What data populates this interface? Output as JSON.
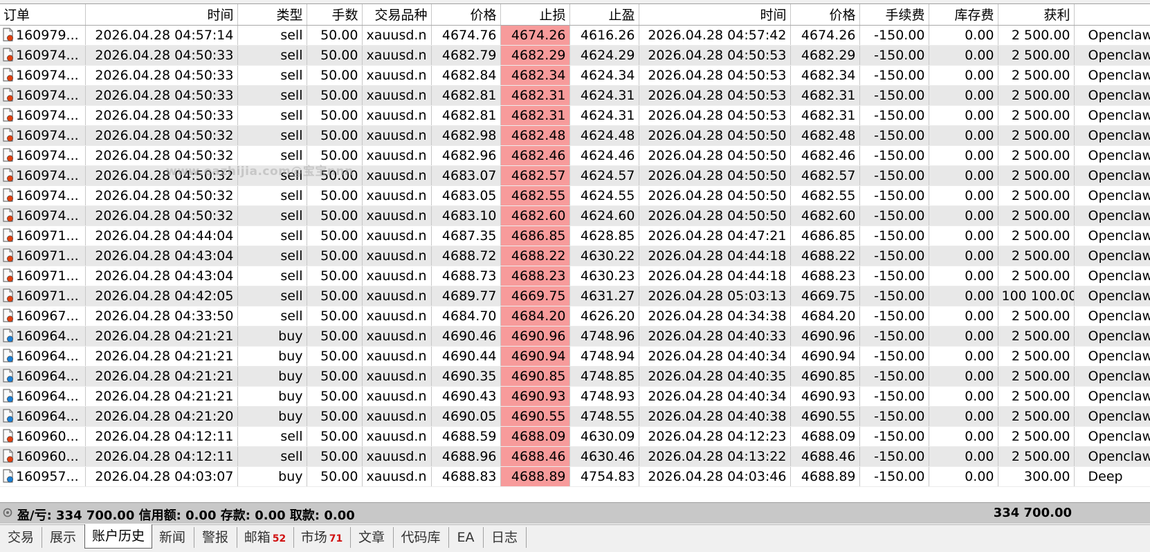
{
  "columns": {
    "order": "订单",
    "open_time": "时间",
    "type": "类型",
    "volume": "手数",
    "symbol": "交易品种",
    "open_price": "价格",
    "sl": "止损",
    "tp": "止盈",
    "close_time": "时间",
    "close_price": "价格",
    "commission": "手续费",
    "swap": "库存费",
    "profit": "获利",
    "comment": ""
  },
  "rows": [
    {
      "order": "160979...",
      "open_time": "2026.04.28 04:57:14",
      "type": "sell",
      "volume": "50.00",
      "symbol": "xauusd.n",
      "open_price": "4674.76",
      "sl": "4674.26",
      "tp": "4616.26",
      "close_time": "2026.04.28 04:57:42",
      "close_price": "4674.26",
      "commission": "-150.00",
      "swap": "0.00",
      "profit": "2 500.00",
      "comment": "Openclaw"
    },
    {
      "order": "160974...",
      "open_time": "2026.04.28 04:50:33",
      "type": "sell",
      "volume": "50.00",
      "symbol": "xauusd.n",
      "open_price": "4682.79",
      "sl": "4682.29",
      "tp": "4624.29",
      "close_time": "2026.04.28 04:50:53",
      "close_price": "4682.29",
      "commission": "-150.00",
      "swap": "0.00",
      "profit": "2 500.00",
      "comment": "Openclaw"
    },
    {
      "order": "160974...",
      "open_time": "2026.04.28 04:50:33",
      "type": "sell",
      "volume": "50.00",
      "symbol": "xauusd.n",
      "open_price": "4682.84",
      "sl": "4682.34",
      "tp": "4624.34",
      "close_time": "2026.04.28 04:50:53",
      "close_price": "4682.34",
      "commission": "-150.00",
      "swap": "0.00",
      "profit": "2 500.00",
      "comment": "Openclaw"
    },
    {
      "order": "160974...",
      "open_time": "2026.04.28 04:50:33",
      "type": "sell",
      "volume": "50.00",
      "symbol": "xauusd.n",
      "open_price": "4682.81",
      "sl": "4682.31",
      "tp": "4624.31",
      "close_time": "2026.04.28 04:50:53",
      "close_price": "4682.31",
      "commission": "-150.00",
      "swap": "0.00",
      "profit": "2 500.00",
      "comment": "Openclaw"
    },
    {
      "order": "160974...",
      "open_time": "2026.04.28 04:50:33",
      "type": "sell",
      "volume": "50.00",
      "symbol": "xauusd.n",
      "open_price": "4682.81",
      "sl": "4682.31",
      "tp": "4624.31",
      "close_time": "2026.04.28 04:50:53",
      "close_price": "4682.31",
      "commission": "-150.00",
      "swap": "0.00",
      "profit": "2 500.00",
      "comment": "Openclaw"
    },
    {
      "order": "160974...",
      "open_time": "2026.04.28 04:50:32",
      "type": "sell",
      "volume": "50.00",
      "symbol": "xauusd.n",
      "open_price": "4682.98",
      "sl": "4682.48",
      "tp": "4624.48",
      "close_time": "2026.04.28 04:50:50",
      "close_price": "4682.48",
      "commission": "-150.00",
      "swap": "0.00",
      "profit": "2 500.00",
      "comment": "Openclaw"
    },
    {
      "order": "160974...",
      "open_time": "2026.04.28 04:50:32",
      "type": "sell",
      "volume": "50.00",
      "symbol": "xauusd.n",
      "open_price": "4682.96",
      "sl": "4682.46",
      "tp": "4624.46",
      "close_time": "2026.04.28 04:50:50",
      "close_price": "4682.46",
      "commission": "-150.00",
      "swap": "0.00",
      "profit": "2 500.00",
      "comment": "Openclaw"
    },
    {
      "order": "160974...",
      "open_time": "2026.04.28 04:50:32",
      "type": "sell",
      "volume": "50.00",
      "symbol": "xauusd.n",
      "open_price": "4683.07",
      "sl": "4682.57",
      "tp": "4624.57",
      "close_time": "2026.04.28 04:50:50",
      "close_price": "4682.57",
      "commission": "-150.00",
      "swap": "0.00",
      "profit": "2 500.00",
      "comment": "Openclaw"
    },
    {
      "order": "160974...",
      "open_time": "2026.04.28 04:50:32",
      "type": "sell",
      "volume": "50.00",
      "symbol": "xauusd.n",
      "open_price": "4683.05",
      "sl": "4682.55",
      "tp": "4624.55",
      "close_time": "2026.04.28 04:50:50",
      "close_price": "4682.55",
      "commission": "-150.00",
      "swap": "0.00",
      "profit": "2 500.00",
      "comment": "Openclaw"
    },
    {
      "order": "160974...",
      "open_time": "2026.04.28 04:50:32",
      "type": "sell",
      "volume": "50.00",
      "symbol": "xauusd.n",
      "open_price": "4683.10",
      "sl": "4682.60",
      "tp": "4624.60",
      "close_time": "2026.04.28 04:50:50",
      "close_price": "4682.60",
      "commission": "-150.00",
      "swap": "0.00",
      "profit": "2 500.00",
      "comment": "Openclaw"
    },
    {
      "order": "160971...",
      "open_time": "2026.04.28 04:44:04",
      "type": "sell",
      "volume": "50.00",
      "symbol": "xauusd.n",
      "open_price": "4687.35",
      "sl": "4686.85",
      "tp": "4628.85",
      "close_time": "2026.04.28 04:47:21",
      "close_price": "4686.85",
      "commission": "-150.00",
      "swap": "0.00",
      "profit": "2 500.00",
      "comment": "Openclaw"
    },
    {
      "order": "160971...",
      "open_time": "2026.04.28 04:43:04",
      "type": "sell",
      "volume": "50.00",
      "symbol": "xauusd.n",
      "open_price": "4688.72",
      "sl": "4688.22",
      "tp": "4630.22",
      "close_time": "2026.04.28 04:44:18",
      "close_price": "4688.22",
      "commission": "-150.00",
      "swap": "0.00",
      "profit": "2 500.00",
      "comment": "Openclaw"
    },
    {
      "order": "160971...",
      "open_time": "2026.04.28 04:43:04",
      "type": "sell",
      "volume": "50.00",
      "symbol": "xauusd.n",
      "open_price": "4688.73",
      "sl": "4688.23",
      "tp": "4630.23",
      "close_time": "2026.04.28 04:44:18",
      "close_price": "4688.23",
      "commission": "-150.00",
      "swap": "0.00",
      "profit": "2 500.00",
      "comment": "Openclaw"
    },
    {
      "order": "160971...",
      "open_time": "2026.04.28 04:42:05",
      "type": "sell",
      "volume": "50.00",
      "symbol": "xauusd.n",
      "open_price": "4689.77",
      "sl": "4669.75",
      "tp": "4631.27",
      "close_time": "2026.04.28 05:03:13",
      "close_price": "4669.75",
      "commission": "-150.00",
      "swap": "0.00",
      "profit": "100 100.00",
      "comment": "Openclaw"
    },
    {
      "order": "160967...",
      "open_time": "2026.04.28 04:33:50",
      "type": "sell",
      "volume": "50.00",
      "symbol": "xauusd.n",
      "open_price": "4684.70",
      "sl": "4684.20",
      "tp": "4626.20",
      "close_time": "2026.04.28 04:34:38",
      "close_price": "4684.20",
      "commission": "-150.00",
      "swap": "0.00",
      "profit": "2 500.00",
      "comment": "Openclaw"
    },
    {
      "order": "160964...",
      "open_time": "2026.04.28 04:21:21",
      "type": "buy",
      "volume": "50.00",
      "symbol": "xauusd.n",
      "open_price": "4690.46",
      "sl": "4690.96",
      "tp": "4748.96",
      "close_time": "2026.04.28 04:40:33",
      "close_price": "4690.96",
      "commission": "-150.00",
      "swap": "0.00",
      "profit": "2 500.00",
      "comment": "Openclaw"
    },
    {
      "order": "160964...",
      "open_time": "2026.04.28 04:21:21",
      "type": "buy",
      "volume": "50.00",
      "symbol": "xauusd.n",
      "open_price": "4690.44",
      "sl": "4690.94",
      "tp": "4748.94",
      "close_time": "2026.04.28 04:40:34",
      "close_price": "4690.94",
      "commission": "-150.00",
      "swap": "0.00",
      "profit": "2 500.00",
      "comment": "Openclaw"
    },
    {
      "order": "160964...",
      "open_time": "2026.04.28 04:21:21",
      "type": "buy",
      "volume": "50.00",
      "symbol": "xauusd.n",
      "open_price": "4690.35",
      "sl": "4690.85",
      "tp": "4748.85",
      "close_time": "2026.04.28 04:40:35",
      "close_price": "4690.85",
      "commission": "-150.00",
      "swap": "0.00",
      "profit": "2 500.00",
      "comment": "Openclaw"
    },
    {
      "order": "160964...",
      "open_time": "2026.04.28 04:21:21",
      "type": "buy",
      "volume": "50.00",
      "symbol": "xauusd.n",
      "open_price": "4690.43",
      "sl": "4690.93",
      "tp": "4748.93",
      "close_time": "2026.04.28 04:40:34",
      "close_price": "4690.93",
      "commission": "-150.00",
      "swap": "0.00",
      "profit": "2 500.00",
      "comment": "Openclaw"
    },
    {
      "order": "160964...",
      "open_time": "2026.04.28 04:21:20",
      "type": "buy",
      "volume": "50.00",
      "symbol": "xauusd.n",
      "open_price": "4690.05",
      "sl": "4690.55",
      "tp": "4748.55",
      "close_time": "2026.04.28 04:40:38",
      "close_price": "4690.55",
      "commission": "-150.00",
      "swap": "0.00",
      "profit": "2 500.00",
      "comment": "Openclaw"
    },
    {
      "order": "160960...",
      "open_time": "2026.04.28 04:12:11",
      "type": "sell",
      "volume": "50.00",
      "symbol": "xauusd.n",
      "open_price": "4688.59",
      "sl": "4688.09",
      "tp": "4630.09",
      "close_time": "2026.04.28 04:12:23",
      "close_price": "4688.09",
      "commission": "-150.00",
      "swap": "0.00",
      "profit": "2 500.00",
      "comment": "Openclaw"
    },
    {
      "order": "160960...",
      "open_time": "2026.04.28 04:12:11",
      "type": "sell",
      "volume": "50.00",
      "symbol": "xauusd.n",
      "open_price": "4688.96",
      "sl": "4688.46",
      "tp": "4630.46",
      "close_time": "2026.04.28 04:13:22",
      "close_price": "4688.46",
      "commission": "-150.00",
      "swap": "0.00",
      "profit": "2 500.00",
      "comment": "Openclaw"
    },
    {
      "order": "160957...",
      "open_time": "2026.04.28 04:03:07",
      "type": "buy",
      "volume": "50.00",
      "symbol": "xauusd.n",
      "open_price": "4688.83",
      "sl": "4688.89",
      "tp": "4754.83",
      "close_time": "2026.04.28 04:03:46",
      "close_price": "4688.89",
      "commission": "-150.00",
      "swap": "0.00",
      "profit": "300.00",
      "comment": "Deep"
    }
  ],
  "summary": {
    "text": "盈/亏: 334 700.00  信用额: 0.00  存款: 0.00  取款: 0.00",
    "total": "334 700.00"
  },
  "tabs": [
    {
      "label": "交易",
      "badge": ""
    },
    {
      "label": "展示",
      "badge": ""
    },
    {
      "label": "账户历史",
      "badge": ""
    },
    {
      "label": "新闻",
      "badge": ""
    },
    {
      "label": "警报",
      "badge": ""
    },
    {
      "label": "邮箱",
      "badge": "52"
    },
    {
      "label": "市场",
      "badge": "71"
    },
    {
      "label": "文章",
      "badge": ""
    },
    {
      "label": "代码库",
      "badge": ""
    },
    {
      "label": "EA",
      "badge": ""
    },
    {
      "label": "日志",
      "badge": ""
    }
  ],
  "active_tab": "账户历史",
  "watermark": "www.eazhijia.com@宝宝nnn",
  "colors": {
    "sl_highlight": "#f79b9b",
    "row_alt": "#e8e8e8",
    "sell_marker": "#e04010",
    "buy_marker": "#1a7fd4",
    "badge": "#d01010"
  },
  "icons": {
    "sell": "order-doc-red-icon",
    "buy": "order-doc-blue-icon",
    "summary": "pnl-circle-icon"
  }
}
